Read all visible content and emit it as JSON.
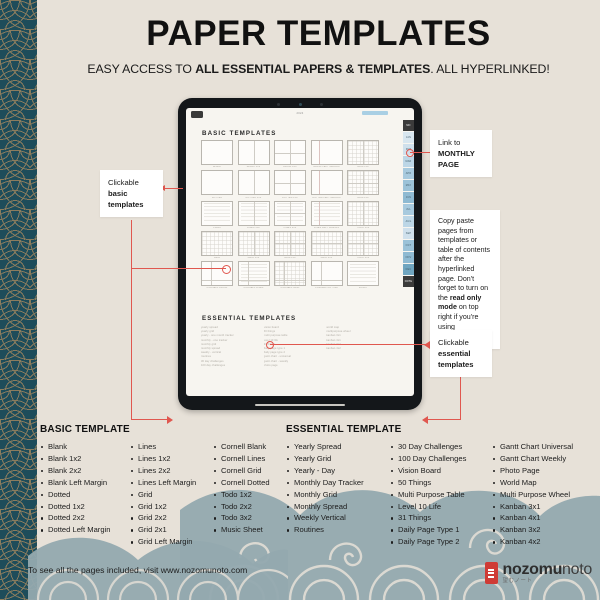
{
  "header": {
    "title": "PAPER TEMPLATES",
    "subtitle_pre": "EASY ACCESS TO ",
    "subtitle_bold": "ALL ESSENTIAL PAPERS & TEMPLATES",
    "subtitle_post": ". ALL HYPERLINKED!"
  },
  "colors": {
    "background": "#e7e1d8",
    "teal": "#1d4c5a",
    "accent_red": "#e0574f",
    "wave_blue": "#8fa7ad",
    "logo_red": "#cf3b35"
  },
  "tablet": {
    "screen_title": "PDF",
    "doc_label": "2024",
    "basic_heading": "BASIC TEMPLATES",
    "essential_heading": "ESSENTIAL TEMPLATES",
    "thumb_rows": [
      [
        {
          "label": "BLANK",
          "kind": "blank"
        },
        {
          "label": "BLANK 1X2",
          "kind": "v-half"
        },
        {
          "label": "BLANK 2X2",
          "kind": "quad"
        },
        {
          "label": "BLANK LEFT MARGIN",
          "kind": "vmargin"
        },
        {
          "label": "GRID 1X2",
          "kind": "grid-v"
        }
      ],
      [
        {
          "label": "DOTTED",
          "kind": "dotted"
        },
        {
          "label": "DOTTED 1X2",
          "kind": "dotted-v"
        },
        {
          "label": "DOTTED 2X2",
          "kind": "dotted-quad"
        },
        {
          "label": "DOTTED LEFT MARGIN",
          "kind": "dotted-margin"
        },
        {
          "label": "GRID 2X2",
          "kind": "grid-quad"
        }
      ],
      [
        {
          "label": "LINES",
          "kind": "lines"
        },
        {
          "label": "LINES 1X2",
          "kind": "lines-v"
        },
        {
          "label": "LINES 2X2",
          "kind": "lines-quad"
        },
        {
          "label": "LINES LEFT MARGIN",
          "kind": "lines-margin"
        },
        {
          "label": "TODO 1X2",
          "kind": "grid-v"
        }
      ],
      [
        {
          "label": "GRID",
          "kind": "grid"
        },
        {
          "label": "GRID 1X2",
          "kind": "grid-v"
        },
        {
          "label": "GRID 2X2",
          "kind": "grid-quad"
        },
        {
          "label": "GRID 2X1",
          "kind": "grid-h"
        },
        {
          "label": "TODO 2X2",
          "kind": "grid-quad"
        }
      ],
      [
        {
          "label": "CORNELL BLANK",
          "kind": "cornell"
        },
        {
          "label": "CORNELL LINES",
          "kind": "cornell-lines"
        },
        {
          "label": "CORNELL GRID",
          "kind": "cornell-grid"
        },
        {
          "label": "CORNELL DOTTED",
          "kind": "cornell-dot"
        },
        {
          "label": "MUSIC",
          "kind": "music"
        }
      ]
    ],
    "essential_cols": [
      [
        "yearly spread",
        "yearly grid",
        "yearly - one month tracker",
        "monthly - one tracker",
        "monthly grid",
        "monthly spread",
        "weekly - vertical",
        "routines",
        "30 day challenges",
        "100 day challenges"
      ],
      [
        "vision board",
        "50 things",
        "multi purpose table",
        "level 10 life",
        "31 things",
        "daily page type 1",
        "daily page type 2",
        "gantt chart - universal",
        "gantt chart - weekly",
        "photo page"
      ],
      [
        "world map",
        "multipurpose wheel",
        "kanban 3x1",
        "kanban 4x1",
        "kanban 3x2",
        "kanban 4x2"
      ]
    ],
    "month_tabs": [
      "MO",
      "JAN",
      "FEB",
      "MAR",
      "APR",
      "MAY",
      "JUN",
      "JUL",
      "AUG",
      "SEP",
      "OCT",
      "NOV",
      "DEC",
      "NOTE"
    ]
  },
  "callouts": {
    "basic": {
      "line1": "Clickable",
      "line2": "basic",
      "line3": "templates"
    },
    "monthly": {
      "line1": "Link to",
      "line2": "MONTHLY",
      "line3": "PAGE"
    },
    "copy": {
      "pre": "Copy paste pages from templates or table of contents after the hyperlinked page. Don't forget to turn on the ",
      "bold": "read only mode",
      "post": " on top right if you're using Goodnotes!"
    },
    "essential": {
      "line1": "Clickable",
      "line2": "essential",
      "line3": "templates"
    }
  },
  "lists": {
    "basic_title": "BASIC TEMPLATE",
    "basic_columns": [
      [
        "Blank",
        "Blank 1x2",
        "Blank 2x2",
        "Blank Left Margin",
        "Dotted",
        "Dotted 1x2",
        "Dotted 2x2",
        "Dotted Left Margin"
      ],
      [
        "Lines",
        "Lines 1x2",
        "Lines 2x2",
        "Lines Left Margin",
        "Grid",
        "Grid 1x2",
        "Grid 2x2",
        "Grid 2x1",
        "Grid Left Margin"
      ],
      [
        "Cornell Blank",
        "Cornell Lines",
        "Cornell Grid",
        "Cornell Dotted",
        "Todo 1x2",
        "Todo 2x2",
        "Todo 3x2",
        "Music Sheet"
      ]
    ],
    "essential_title": "ESSENTIAL TEMPLATE",
    "essential_columns": [
      [
        "Yearly Spread",
        "Yearly Grid",
        "Yearly - Day",
        "Monthly Day Tracker",
        "Monthly Grid",
        "Monthly Spread",
        "Weekly Vertical",
        "Routines"
      ],
      [
        "30 Day Challenges",
        "100 Day Challenges",
        "Vision Board",
        "50 Things",
        "Multi Purpose Table",
        "Level 10 Life",
        "31 Things",
        "Daily Page Type 1",
        "Daily Page Type 2"
      ],
      [
        "Gantt Chart Universal",
        "Gantt Chart Weekly",
        "Photo Page",
        "World Map",
        "Multi Purpose Wheel",
        "Kanban 3x1",
        "Kanban 4x1",
        "Kanban 3x2",
        "Kanban 4x2"
      ]
    ]
  },
  "footer": {
    "text": "To see all the pages included, visit www.nozomunoto.com",
    "logo_bold": "nozomu",
    "logo_light": "noto",
    "logo_sub": "望むノート"
  }
}
